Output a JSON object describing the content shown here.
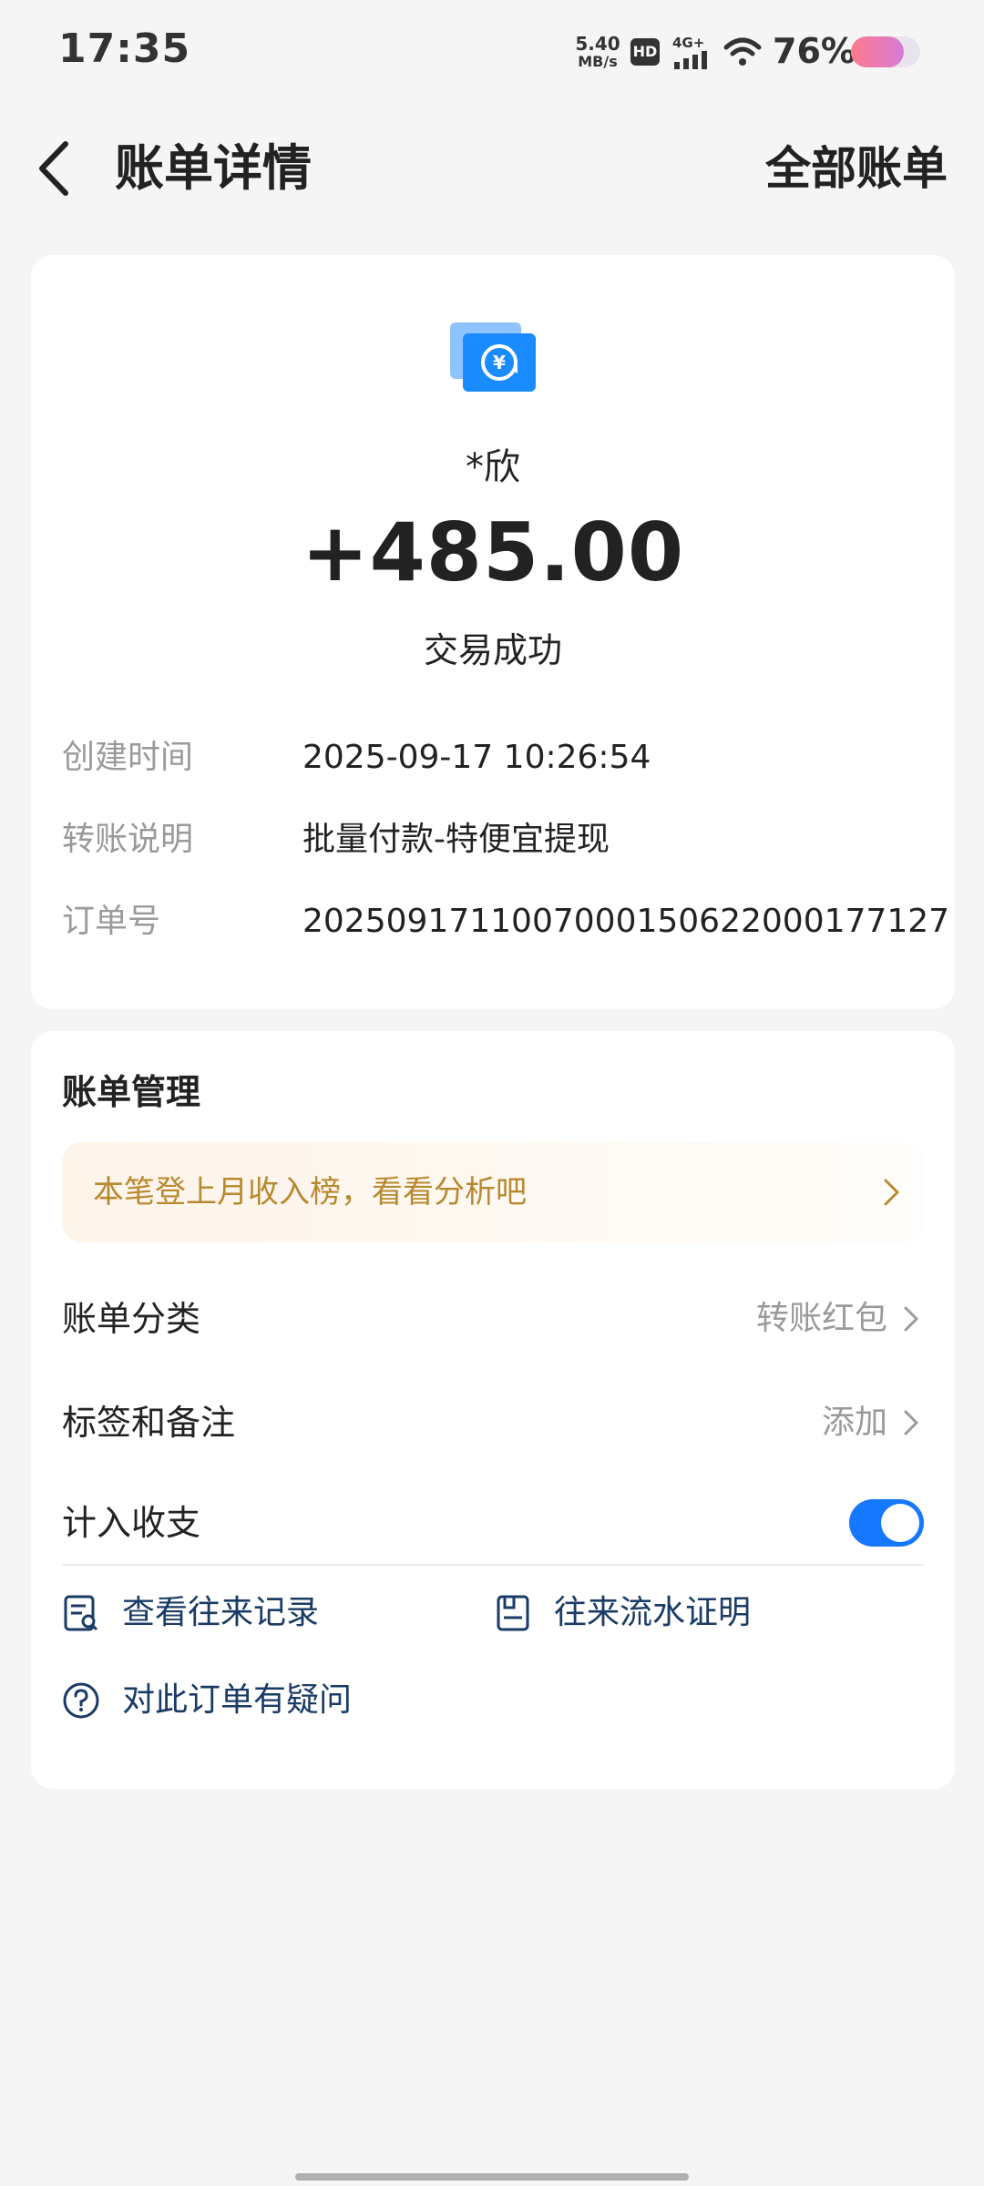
{
  "status_bar": {
    "time": "17:35",
    "net_speed": "5.40",
    "net_unit": "MB/s",
    "hd_badge": "HD",
    "network": "4G+",
    "battery_pct": "76%",
    "battery_level": 0.76
  },
  "header": {
    "title": "账单详情",
    "all_bills": "全部账单",
    "back_icon": "chevron-left-icon"
  },
  "transaction": {
    "icon": "transfer-yuan-icon",
    "payer": "*欣",
    "amount": "+485.00",
    "status": "交易成功",
    "details": [
      {
        "label": "创建时间",
        "value": "2025-09-17 10:26:54"
      },
      {
        "label": "转账说明",
        "value": "批量付款-特便宜提现"
      },
      {
        "label": "订单号",
        "value": "2025091711007000150622000177127"
      }
    ]
  },
  "manage": {
    "title": "账单管理",
    "promo_text": "本笔登上月收入榜，看看分析吧",
    "category_label": "账单分类",
    "category_value": "转账红包",
    "tags_label": "标签和备注",
    "tags_value": "添加",
    "count_label": "计入收支",
    "count_enabled": true,
    "links": {
      "history": "查看往来记录",
      "proof": "往来流水证明",
      "question": "对此订单有疑问"
    }
  },
  "colors": {
    "accent": "#1677ff",
    "link": "#1a3b66",
    "promo": "#b8892f"
  }
}
